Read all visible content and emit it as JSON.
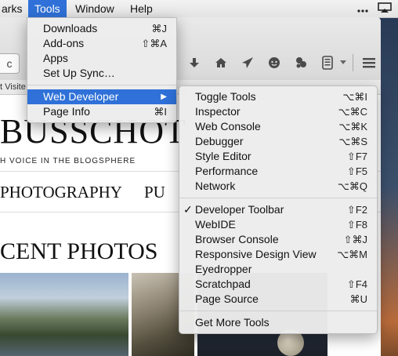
{
  "menubar": {
    "items": [
      "arks",
      "Tools",
      "Window",
      "Help"
    ],
    "right_icons": [
      "more-dots-icon",
      "airplay-icon"
    ]
  },
  "toolbar": {
    "reload_glyph": "c",
    "icons": [
      "download-icon",
      "home-icon",
      "share-icon",
      "chat-icon",
      "hello-icon",
      "reader-icon",
      "menu-icon"
    ]
  },
  "bookmarks": {
    "text": "t Visite"
  },
  "page": {
    "site_title": "BUSSCHOT",
    "subtitle": "H VOICE IN THE BLOGSPHERE",
    "nav": [
      "PHOTOGRAPHY",
      "PU"
    ],
    "section_heading": "CENT PHOTOS"
  },
  "tools_menu": {
    "items": [
      {
        "label": "Downloads",
        "shortcut": "⌘J"
      },
      {
        "label": "Add-ons",
        "shortcut": "⇧⌘A"
      },
      {
        "label": "Apps",
        "shortcut": ""
      },
      {
        "label": "Set Up Sync…",
        "shortcut": ""
      },
      {
        "label": "Web Developer",
        "shortcut": "▶"
      },
      {
        "label": "Page Info",
        "shortcut": "⌘I"
      }
    ]
  },
  "dev_menu": {
    "group1": [
      {
        "label": "Toggle Tools",
        "shortcut": "⌥⌘I"
      },
      {
        "label": "Inspector",
        "shortcut": "⌥⌘C"
      },
      {
        "label": "Web Console",
        "shortcut": "⌥⌘K"
      },
      {
        "label": "Debugger",
        "shortcut": "⌥⌘S"
      },
      {
        "label": "Style Editor",
        "shortcut": "⇧F7"
      },
      {
        "label": "Performance",
        "shortcut": "⇧F5"
      },
      {
        "label": "Network",
        "shortcut": "⌥⌘Q"
      }
    ],
    "group2": [
      {
        "label": "Developer Toolbar",
        "shortcut": "⇧F2",
        "checked": true
      },
      {
        "label": "WebIDE",
        "shortcut": "⇧F8"
      },
      {
        "label": "Browser Console",
        "shortcut": "⇧⌘J"
      },
      {
        "label": "Responsive Design View",
        "shortcut": "⌥⌘M"
      },
      {
        "label": "Eyedropper",
        "shortcut": ""
      },
      {
        "label": "Scratchpad",
        "shortcut": "⇧F4"
      },
      {
        "label": "Page Source",
        "shortcut": "⌘U"
      }
    ],
    "group3": [
      {
        "label": "Get More Tools",
        "shortcut": ""
      }
    ],
    "check_glyph": "✓"
  },
  "colors": {
    "highlight": "#2f71d8"
  }
}
